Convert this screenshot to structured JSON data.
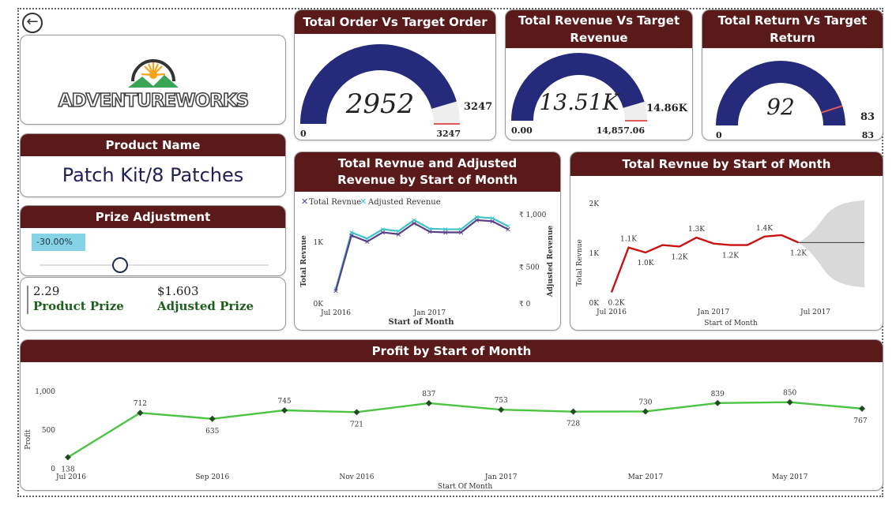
{
  "back_icon": "arrow-left-circle-icon",
  "logo": {
    "text": "ADVENTUREWORKS"
  },
  "product": {
    "header": "Product Name",
    "value": "Patch Kit/8 Patches"
  },
  "prize": {
    "header": "Prize Adjustment",
    "value_label": "-30.00%",
    "slider_fraction": 0.35,
    "product_prize": "2.29",
    "product_prize_label": "Product Prize",
    "adjusted_prize": "$1.603",
    "adjusted_prize_label": "Adjusted Prize"
  },
  "gauges": [
    {
      "title": "Total Order Vs Target Order",
      "value_text": "2952",
      "value": 2952,
      "target": 3247,
      "target_label": "3247",
      "min_label": "0",
      "max_label": "3247"
    },
    {
      "title": "Total Revenue Vs Target Revenue",
      "value_text": "13.51K",
      "value": 13510,
      "target": 14857.06,
      "target_label": "14.86K",
      "min_label": "0.00",
      "max_label": "14,857.06"
    },
    {
      "title": "Total Return Vs Target Return",
      "value_text": "92",
      "value": 92,
      "target": 83,
      "target_label": "83",
      "min_label": "0",
      "max_label": "83"
    }
  ],
  "colors": {
    "header": "#5b1a1a",
    "gauge_fill": "#252b7a",
    "gauge_bg": "#eeeeee",
    "target": "#e05a5a",
    "total_rev": "#5a3d8a",
    "adjusted_rev": "#3cc5c8",
    "red_line": "#cc1111",
    "forecast": "#d9d9d9",
    "profit": "#4cc443",
    "profit_marker": "#1e4d1e"
  },
  "chart_data": [
    {
      "type": "line",
      "title": "Total Revnue and Adjusted Revenue by Start of Month",
      "xlabel": "Start of Month",
      "ylabel": "Total Revnue",
      "y2label": "Adjusted Revenue",
      "x_ticks": [
        "Jul 2016",
        "Jan 2017"
      ],
      "y_ticks": [
        "0K",
        "1K"
      ],
      "y2_ticks": [
        "₹ 0",
        "₹ 500",
        "₹ 1,000"
      ],
      "ylim": [
        0,
        1400
      ],
      "x": [
        "Jul 2016",
        "Aug 2016",
        "Sep 2016",
        "Oct 2016",
        "Nov 2016",
        "Dec 2016",
        "Jan 2017",
        "Feb 2017",
        "Mar 2017",
        "Apr 2017",
        "May 2017",
        "Jun 2017"
      ],
      "series": [
        {
          "name": "Total Revnue",
          "values": [
            200,
            1100,
            1000,
            1150,
            1120,
            1300,
            1160,
            1150,
            1150,
            1350,
            1330,
            1200
          ]
        },
        {
          "name": "Adjusted Revenue",
          "values": [
            230,
            1150,
            1050,
            1200,
            1170,
            1350,
            1210,
            1200,
            1200,
            1400,
            1380,
            1250
          ]
        }
      ]
    },
    {
      "type": "line",
      "title": "Total Revnue by Start of Month",
      "xlabel": "Start of Month",
      "ylabel": "Total Revnue",
      "x_ticks": [
        "Jul 2016",
        "Jan 2017",
        "Jul 2017"
      ],
      "y_ticks": [
        "0K",
        "1K",
        "2K"
      ],
      "ylim": [
        0,
        2000
      ],
      "x": [
        "Jul 2016",
        "Aug 2016",
        "Sep 2016",
        "Oct 2016",
        "Nov 2016",
        "Dec 2016",
        "Jan 2017",
        "Feb 2017",
        "Mar 2017",
        "Apr 2017",
        "May 2017",
        "Jun 2017"
      ],
      "values": [
        200,
        1100,
        1000,
        1150,
        1120,
        1300,
        1180,
        1150,
        1150,
        1320,
        1350,
        1200
      ],
      "labels": [
        "0.2K",
        "1.1K",
        "1.0K",
        "",
        "1.2K",
        "1.3K",
        "",
        "1.2K",
        "",
        "1.4K",
        "",
        "1.2K"
      ],
      "forecast": {
        "start": "Jun 2017",
        "end": "Dec 2017",
        "value": 1200,
        "upper": 2050,
        "lower": 300
      }
    },
    {
      "type": "line",
      "title": "Profit by Start of Month",
      "xlabel": "Start Of Month",
      "ylabel": "Profit",
      "x_ticks": [
        "Jul 2016",
        "Sep 2016",
        "Nov 2016",
        "Jan 2017",
        "Mar 2017",
        "May 2017"
      ],
      "y_ticks": [
        "0",
        "500",
        "1,000"
      ],
      "ylim": [
        0,
        1000
      ],
      "x": [
        "Jul 2016",
        "Aug 2016",
        "Sep 2016",
        "Oct 2016",
        "Nov 2016",
        "Dec 2016",
        "Jan 2017",
        "Feb 2017",
        "Mar 2017",
        "Apr 2017",
        "May 2017",
        "Jun 2017"
      ],
      "values": [
        138,
        712,
        635,
        745,
        721,
        837,
        753,
        728,
        730,
        839,
        850,
        767
      ]
    }
  ]
}
